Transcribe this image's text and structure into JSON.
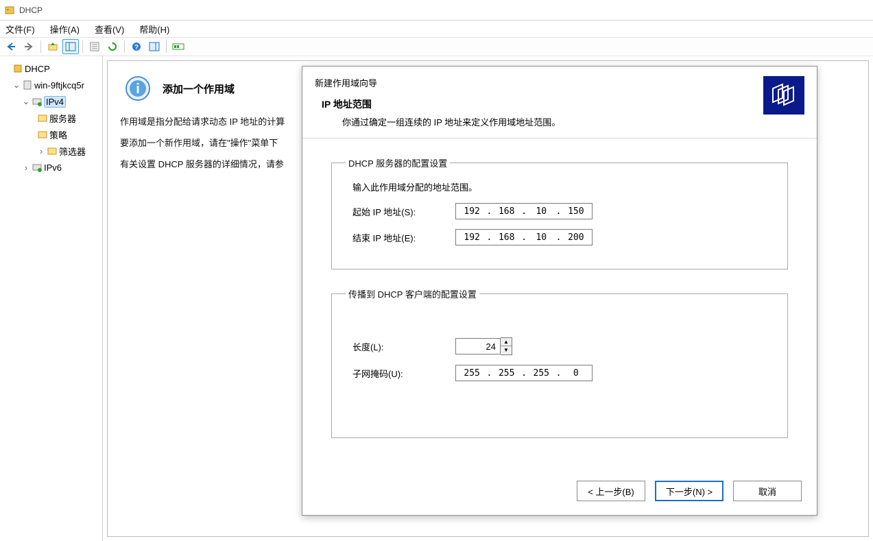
{
  "window": {
    "title": "DHCP"
  },
  "menubar": {
    "file": "文件(F)",
    "action": "操作(A)",
    "view": "查看(V)",
    "help": "帮助(H)"
  },
  "tree": {
    "root": "DHCP",
    "server": "win-9ftjkcq5r",
    "ipv4": "IPv4",
    "server_options": "服务器",
    "policies": "策略",
    "filters": "筛选器",
    "ipv6": "IPv6"
  },
  "content": {
    "title": "添加一个作用域",
    "p1": "作用域是指分配给请求动态 IP 地址的计算",
    "p2": "要添加一个新作用域，请在\"操作\"菜单下",
    "p3": "有关设置 DHCP 服务器的详细情况，请参"
  },
  "wizard": {
    "top_title": "新建作用域向导",
    "heading": "IP 地址范围",
    "desc": "你通过确定一组连续的 IP 地址来定义作用域地址范围。",
    "group1_legend": "DHCP 服务器的配置设置",
    "group1_note": "输入此作用域分配的地址范围。",
    "start_label": "起始 IP 地址(S):",
    "end_label": "结束 IP 地址(E):",
    "start_ip": {
      "o1": "192",
      "o2": "168",
      "o3": "10",
      "o4": "150"
    },
    "end_ip": {
      "o1": "192",
      "o2": "168",
      "o3": "10",
      "o4": "200"
    },
    "group2_legend": "传播到 DHCP 客户端的配置设置",
    "length_label": "长度(L):",
    "length_value": "24",
    "mask_label": "子网掩码(U):",
    "mask": {
      "o1": "255",
      "o2": "255",
      "o3": "255",
      "o4": "0"
    },
    "btn_back": "< 上一步(B)",
    "btn_next": "下一步(N) >",
    "btn_cancel": "取消"
  }
}
